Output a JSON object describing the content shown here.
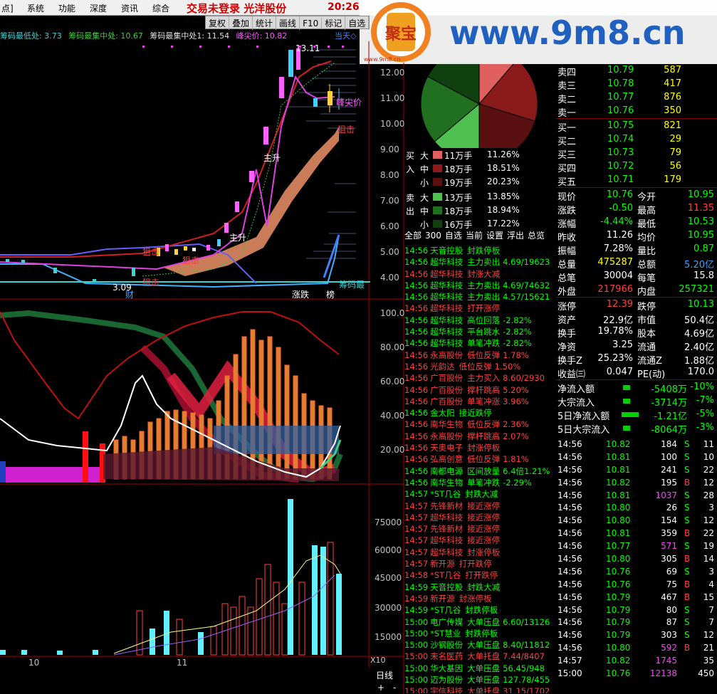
{
  "menu": {
    "items": [
      "点]",
      "系统",
      "功能",
      "深度",
      "资讯",
      "综合"
    ],
    "title": "交易未登录  光洋股份",
    "clock": "20:26:"
  },
  "watermark": {
    "site": "www.9m8.cn",
    "sub": "www.9m8.cn",
    "badge": "聚宝"
  },
  "chip_info": {
    "low": "筹码最低处: 3.73",
    "center": "筹码最集中处: 10.67",
    "center2": "筹码最集中处1: 11.54",
    "peak": "峰尖价: 10.82",
    "today": "当天◇"
  },
  "toolbar": [
    "复权",
    "叠加",
    "统计",
    "画线",
    "F10",
    "标记",
    "自选"
  ],
  "price_axis": [
    "12.00",
    "11.00",
    "10.00",
    "9.00",
    "8.00",
    "7.00",
    "6.00",
    "5.00",
    "4.00"
  ],
  "kline_labels": {
    "high": "13.11",
    "low": "3.09",
    "peak_price": "峰尖价",
    "ambush1": "狙击",
    "ambush2": "狙击",
    "ambush3": "狙击",
    "ambush4": "狙击",
    "rise1": "主升",
    "rise2": "主升",
    "cai": "财",
    "zhangdie": "涨跌",
    "bang": "榜",
    "chip_low": "筹码最"
  },
  "ind_axis": [
    "100.0",
    "80.00",
    "60.00",
    "40.00",
    "20.00"
  ],
  "vol_axis": [
    "75000",
    "60000",
    "45000",
    "30000",
    "15000"
  ],
  "date_axis": [
    "10",
    "11"
  ],
  "x10": "X10",
  "rixian": "日线",
  "zoom": [
    "+",
    "-"
  ],
  "money_flow": {
    "buy": [
      {
        "side": "买",
        "size": "大",
        "amount": "11万手",
        "pct": "11.26%",
        "color": "#e06060"
      },
      {
        "side": "入",
        "size": "中",
        "amount": "18万手",
        "pct": "18.51%",
        "color": "#8b1a1a"
      },
      {
        "side": "",
        "size": "小",
        "amount": "19万手",
        "pct": "20.23%",
        "color": "#5a1010"
      }
    ],
    "sell": [
      {
        "side": "卖",
        "size": "大",
        "amount": "13万手",
        "pct": "13.85%",
        "color": "#50c050"
      },
      {
        "side": "出",
        "size": "中",
        "amount": "18万手",
        "pct": "18.94%",
        "color": "#207020"
      },
      {
        "side": "",
        "size": "小",
        "amount": "16万手",
        "pct": "17.22%",
        "color": "#104010"
      }
    ]
  },
  "pie": [
    {
      "label": "buy-large",
      "pct": 11.26,
      "color": "#e06060"
    },
    {
      "label": "buy-mid",
      "pct": 18.51,
      "color": "#8b1a1a"
    },
    {
      "label": "buy-small",
      "pct": 20.23,
      "color": "#5a1010"
    },
    {
      "label": "sell-large",
      "pct": 13.85,
      "color": "#50c050"
    },
    {
      "label": "sell-mid",
      "pct": 18.94,
      "color": "#207020"
    },
    {
      "label": "sell-small",
      "pct": 17.22,
      "color": "#104010"
    }
  ],
  "options": [
    "全部",
    "300",
    "自选",
    "当前",
    "设置",
    "浮出",
    "总览"
  ],
  "news": [
    [
      "14:56",
      "天音控股",
      "封跌停板",
      ""
    ],
    [
      "14:56",
      "超华科技",
      "主力卖出",
      "4.69/19623"
    ],
    [
      "14:56",
      "超华科技",
      "封涨大减",
      ""
    ],
    [
      "14:56",
      "超华科技",
      "主力卖出",
      "4.69/74632"
    ],
    [
      "14:56",
      "超华科技",
      "主力卖出",
      "4.57/15621"
    ],
    [
      "14:56",
      "超华科技",
      "打开涨停",
      ""
    ],
    [
      "14:56",
      "超华科技",
      "高位回落",
      "-2.82%"
    ],
    [
      "14:56",
      "超华科技",
      "平台跳水",
      "-2.82%"
    ],
    [
      "14:56",
      "超华科技",
      "单笔冲跌",
      "-2.82%"
    ],
    [
      "14:56",
      "永高股份",
      "低位反弹",
      "1.78%"
    ],
    [
      "14:56",
      "光韵达",
      "低位反弹",
      "1.50%"
    ],
    [
      "14:56",
      "广百股份",
      "主力买入",
      "8.60/2930"
    ],
    [
      "14:56",
      "广百股份",
      "撑杆跳高",
      "5.20%"
    ],
    [
      "14:56",
      "广百股份",
      "单笔冲涨",
      "3.96%"
    ],
    [
      "14:56",
      "金太阳",
      "接近跌停",
      ""
    ],
    [
      "14:56",
      "南华生物",
      "低位反弹",
      "2.36%"
    ],
    [
      "14:56",
      "永高股份",
      "撑杆跳高",
      "2.07%"
    ],
    [
      "14:56",
      "天奥电子",
      "封涨停板",
      ""
    ],
    [
      "14:56",
      "弘高创意",
      "低位反弹",
      "1.81%"
    ],
    [
      "14:56",
      "南都电源",
      "区间放量",
      "6.4倍1.21%"
    ],
    [
      "14:56",
      "南华生物",
      "单笔冲跌",
      "-2.29%"
    ],
    [
      "14:57",
      "*ST几谷",
      "封跌大减",
      ""
    ],
    [
      "14:57",
      "先锋新材",
      "接近涨停",
      ""
    ],
    [
      "14:57",
      "超华科技",
      "接近涨停",
      ""
    ],
    [
      "14:57",
      "先锋新材",
      "接近涨停",
      ""
    ],
    [
      "14:57",
      "超华科技",
      "接近涨停",
      ""
    ],
    [
      "14:57",
      "超华科技",
      "封涨停板",
      ""
    ],
    [
      "14:57",
      "新开源",
      "打开跌停",
      ""
    ],
    [
      "14:58",
      "*ST几谷",
      "打开跌停",
      ""
    ],
    [
      "14:59",
      "天音控股",
      "封跌大减",
      ""
    ],
    [
      "14:59",
      "新开源",
      "封涨停板",
      ""
    ],
    [
      "14:59",
      "*ST几谷",
      "封跌停板",
      ""
    ],
    [
      "15:00",
      "电广传媒",
      "大单压盘",
      "6.60/13126"
    ],
    [
      "15:00",
      "*ST慧业",
      "封跌停板",
      ""
    ],
    [
      "15:00",
      "沙钢股份",
      "大单压盘",
      "8.40/11812"
    ],
    [
      "15:00",
      "未名医药",
      "大单托盘",
      "7.44/8407"
    ],
    [
      "15:00",
      "华大基因",
      "大单压盘",
      "56.45/948"
    ],
    [
      "15:00",
      "迈为股份",
      "大单压盘",
      "127.78/455"
    ],
    [
      "15:00",
      "宇信科技",
      "大单托盘",
      "31.15/1702"
    ]
  ],
  "order_book": {
    "asks": [
      {
        "label": "卖四",
        "price": "10.79",
        "vol": "587"
      },
      {
        "label": "卖三",
        "price": "10.78",
        "vol": "417"
      },
      {
        "label": "卖二",
        "price": "10.77",
        "vol": "876"
      },
      {
        "label": "卖一",
        "price": "10.76",
        "vol": "350"
      }
    ],
    "bids": [
      {
        "label": "买一",
        "price": "10.75",
        "vol": "821"
      },
      {
        "label": "买二",
        "price": "10.74",
        "vol": "29"
      },
      {
        "label": "买三",
        "price": "10.73",
        "vol": "79"
      },
      {
        "label": "买四",
        "price": "10.72",
        "vol": "56"
      },
      {
        "label": "买五",
        "price": "10.71",
        "vol": "179"
      }
    ]
  },
  "stats": [
    [
      {
        "k": "现价",
        "v": "10.76",
        "c": "#00ff00"
      },
      {
        "k": "今开",
        "v": "10.95",
        "c": "#00ff00"
      }
    ],
    [
      {
        "k": "涨跌",
        "v": "-0.50",
        "c": "#00ff00"
      },
      {
        "k": "最高",
        "v": "11.35",
        "c": "#ff4040"
      }
    ],
    [
      {
        "k": "涨幅",
        "v": "-4.44%",
        "c": "#00ff00"
      },
      {
        "k": "最低",
        "v": "10.53",
        "c": "#00ff00"
      }
    ],
    [
      {
        "k": "昨收",
        "v": "11.26",
        "c": "#ffffff"
      },
      {
        "k": "均价",
        "v": "10.95",
        "c": "#00ff00"
      }
    ],
    [
      {
        "k": "振幅",
        "v": "7.28%",
        "c": "#ffffff"
      },
      {
        "k": "量比",
        "v": "0.87",
        "c": "#00ff00"
      }
    ],
    [
      {
        "k": "总量",
        "v": "475287",
        "c": "#ffff00"
      },
      {
        "k": "总额",
        "v": "5.20亿",
        "c": "#40a0ff"
      }
    ],
    [
      {
        "k": "总笔",
        "v": "30004",
        "c": "#ffffff"
      },
      {
        "k": "每笔",
        "v": "15.8",
        "c": "#ffffff"
      }
    ],
    [
      {
        "k": "外盘",
        "v": "217966",
        "c": "#ff4040"
      },
      {
        "k": "内盘",
        "v": "257321",
        "c": "#00ff00"
      }
    ],
    [
      {
        "k": "涨停",
        "v": "12.39",
        "c": "#ff4040"
      },
      {
        "k": "跌停",
        "v": "10.13",
        "c": "#00ff00"
      }
    ],
    [
      {
        "k": "资产",
        "v": "22.9亿",
        "c": "#ffffff"
      },
      {
        "k": "市值",
        "v": "50.4亿",
        "c": "#ffffff"
      }
    ],
    [
      {
        "k": "换手",
        "v": "19.78%",
        "c": "#ffffff"
      },
      {
        "k": "股本",
        "v": "4.69亿",
        "c": "#ffffff"
      }
    ],
    [
      {
        "k": "净资",
        "v": "3.25",
        "c": "#ffffff"
      },
      {
        "k": "流通",
        "v": "2.40亿",
        "c": "#ffffff"
      }
    ],
    [
      {
        "k": "换手Z",
        "v": "25.23%",
        "c": "#ffffff"
      },
      {
        "k": "流通Z",
        "v": "1.88亿",
        "c": "#ffffff"
      }
    ],
    [
      {
        "k": "收益㈢",
        "v": "0.047",
        "c": "#ffffff"
      },
      {
        "k": "PE(动)",
        "v": "170.0",
        "c": "#ffffff"
      }
    ]
  ],
  "net_flow": [
    {
      "k": "净流入额",
      "v": "-5408万",
      "p": "-10%"
    },
    {
      "k": "大宗流入",
      "v": "-3714万",
      "p": "-7%"
    },
    {
      "k": "5日净流入额",
      "v": "-1.21亿",
      "p": "-5%"
    },
    {
      "k": "5日大宗流入",
      "v": "-8064万",
      "p": "-3%"
    }
  ],
  "ticks": [
    [
      "14:56",
      "10.82",
      "184",
      "S",
      "11"
    ],
    [
      "14:56",
      "10.81",
      "100",
      "S",
      "10"
    ],
    [
      "14:56",
      "10.81",
      "241",
      "S",
      "22"
    ],
    [
      "14:56",
      "10.82",
      "195",
      "B",
      "12"
    ],
    [
      "14:56",
      "10.81",
      "1037",
      "S",
      "28"
    ],
    [
      "14:56",
      "10.80",
      "26",
      "S",
      "3"
    ],
    [
      "14:56",
      "10.80",
      "154",
      "S",
      "12"
    ],
    [
      "14:56",
      "10.81",
      "359",
      "B",
      "22"
    ],
    [
      "14:56",
      "10.77",
      "571",
      "S",
      "19"
    ],
    [
      "14:56",
      "10.80",
      "305",
      "B",
      "14"
    ],
    [
      "14:56",
      "10.76",
      "69",
      "S",
      "3"
    ],
    [
      "14:56",
      "10.76",
      "75",
      "B",
      "4"
    ],
    [
      "14:56",
      "10.79",
      "467",
      "B",
      "15"
    ],
    [
      "14:56",
      "10.79",
      "80",
      "S",
      "7"
    ],
    [
      "14:56",
      "10.79",
      "87",
      "S",
      "7"
    ],
    [
      "14:56",
      "10.79",
      "303",
      "S",
      "12"
    ],
    [
      "14:56",
      "10.80",
      "592",
      "B",
      "21"
    ],
    [
      "14:57",
      "10.82",
      "1745",
      "",
      "35"
    ],
    [
      "15:00",
      "10.76",
      "12138",
      "",
      "450"
    ]
  ]
}
